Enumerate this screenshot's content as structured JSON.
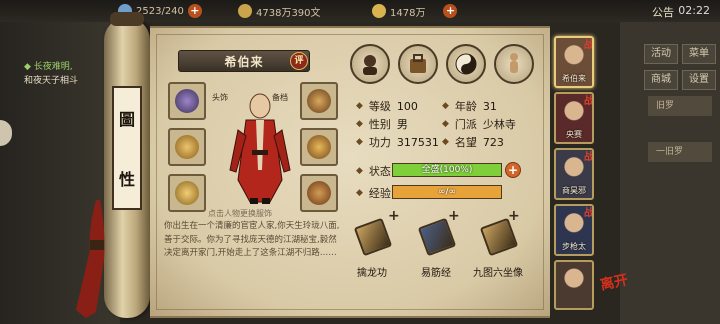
{
  "topbar": {
    "stamina": "2523/240",
    "coins": "4738万390文",
    "gold": "1478万",
    "time": "02:22",
    "notice_label": "公告"
  },
  "background": {
    "left_line1": "◆ 长夜难明,",
    "left_line2": "和夜天子相斗",
    "side_buttons": [
      "活动",
      "菜单",
      "商城",
      "设置"
    ],
    "side_slot1": "旧罗",
    "side_slot2": "一旧罗"
  },
  "scroll": {
    "card_char1": "圖",
    "card_char2": "性"
  },
  "character": {
    "name": "希伯来",
    "rate_label": "评",
    "hint": "点击人物更换服饰",
    "slot_label1": "头饰",
    "slot_label2": "备档",
    "description": "你出生在一个清廉的官宦人家,你天生玲珑八面,善于交际。你为了寻找庞天德的江湖秘宝,毅然决定离开家门,开始走上了这条江湖不归路……"
  },
  "stats": {
    "level_label": "等级",
    "level_value": "100",
    "age_label": "年龄",
    "age_value": "31",
    "gender_label": "性别",
    "gender_value": "男",
    "sect_label": "门派",
    "sect_value": "少林寺",
    "power_label": "功力",
    "power_value": "317531",
    "fame_label": "名望",
    "fame_value": "723",
    "status_label": "状态",
    "status_value": "全盛(100%)",
    "status_fill": 1.0,
    "exp_label": "经验",
    "exp_value": "∞/∞",
    "exp_fill": 1.0
  },
  "skills": [
    {
      "name": "擒龙功",
      "color": "#c9a25e"
    },
    {
      "name": "易筋经",
      "color": "#4a5f87"
    },
    {
      "name": "九图六坐像",
      "color": "#c9a25e"
    }
  ],
  "party": [
    {
      "name": "希伯来",
      "selected": true
    },
    {
      "name": "央赛",
      "selected": false
    },
    {
      "name": "商昊邪",
      "selected": false
    },
    {
      "name": "步枪太",
      "selected": false
    },
    {
      "name": "",
      "selected": false
    }
  ],
  "party_tag": "战",
  "leave_label": "离开",
  "colors": {
    "status_fill": "#7fcf3a",
    "exp_fill": "#e8a23a",
    "accent": "#d3301c"
  }
}
